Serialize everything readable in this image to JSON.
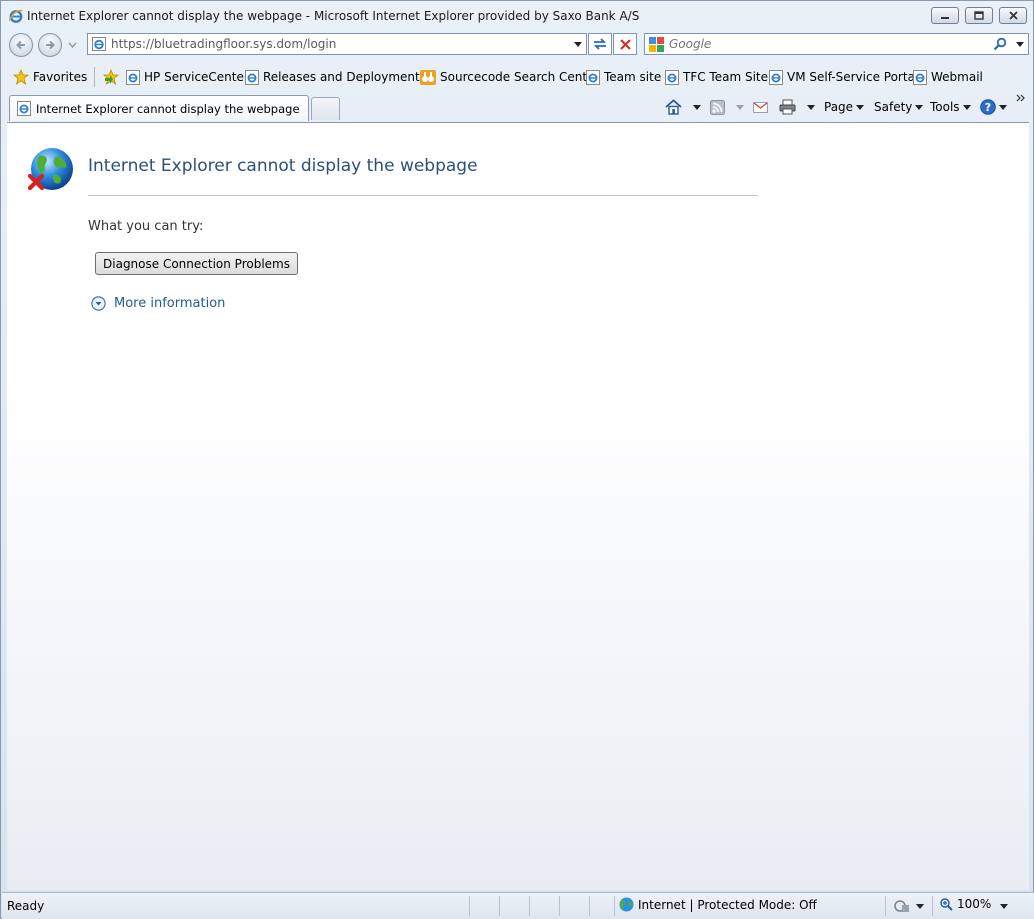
{
  "window": {
    "title": "Internet Explorer cannot display the webpage - Microsoft Internet Explorer provided by Saxo Bank A/S"
  },
  "address_bar": {
    "url": "https://bluetradingfloor.sys.dom/login"
  },
  "search": {
    "placeholder": "Google"
  },
  "favorites_bar": {
    "favorites_label": "Favorites",
    "links": [
      {
        "label": "HP ServiceCenter",
        "icon": "ie-page-icon"
      },
      {
        "label": "Releases and Deployment ...",
        "icon": "ie-page-icon"
      },
      {
        "label": "Sourcecode Search Center",
        "icon": "binoculars-icon"
      },
      {
        "label": "Team site",
        "icon": "ie-page-icon"
      },
      {
        "label": "TFC Team Site",
        "icon": "ie-page-icon"
      },
      {
        "label": "VM Self-Service Portal",
        "icon": "ie-page-icon"
      },
      {
        "label": "Webmail",
        "icon": "ie-page-icon"
      }
    ]
  },
  "tabs": [
    {
      "label": "Internet Explorer cannot display the webpage",
      "active": true
    }
  ],
  "command_bar": {
    "page_label": "Page",
    "safety_label": "Safety",
    "tools_label": "Tools"
  },
  "page": {
    "error_title": "Internet Explorer cannot display the webpage",
    "what_you_can_try": "What you can try:",
    "diagnose_button": "Diagnose Connection Problems",
    "more_information": "More information"
  },
  "status_bar": {
    "status_text": "Ready",
    "zone_text": "Internet | Protected Mode: Off",
    "zoom_text": "100%"
  },
  "colors": {
    "error_title": "#2c5077",
    "link": "#1e5d8c"
  }
}
